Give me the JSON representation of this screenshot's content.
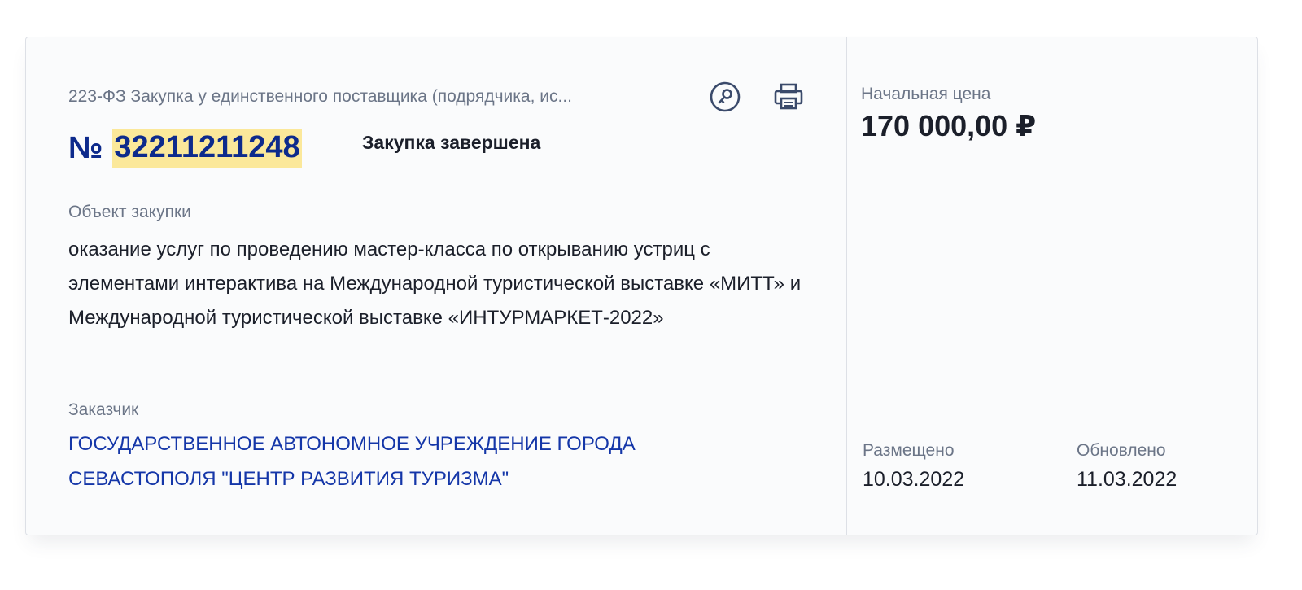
{
  "procurement": {
    "law_type": "223-ФЗ Закупка у единственного поставщика (подрядчика, ис...",
    "number_prefix": "№",
    "number": "32211211248",
    "status": "Закупка завершена",
    "object_label": "Объект закупки",
    "object_text": "оказание услуг по проведению мастер-класса по открыванию устриц с элементами интерактива на Международной туристической выставке «МИТТ» и Международной туристической выставке «ИНТУРМАРКЕТ-2022»",
    "customer_label": "Заказчик",
    "customer_name": "ГОСУДАРСТВЕННОЕ АВТОНОМНОЕ УЧРЕЖДЕНИЕ ГОРОДА СЕВАСТОПОЛЯ \"ЦЕНТР РАЗВИТИЯ ТУРИЗМА\""
  },
  "pricing": {
    "label": "Начальная цена",
    "value": "170 000,00 ₽"
  },
  "dates": {
    "posted_label": "Размещено",
    "posted_value": "10.03.2022",
    "updated_label": "Обновлено",
    "updated_value": "11.03.2022"
  },
  "actions": {
    "key_icon": "key-circle-icon",
    "print_icon": "printer-icon"
  },
  "colors": {
    "number": "#0d2a8c",
    "highlight": "#fbe89a",
    "link": "#1436a8",
    "muted": "#6b7587",
    "icon": "#3a4a6b"
  }
}
